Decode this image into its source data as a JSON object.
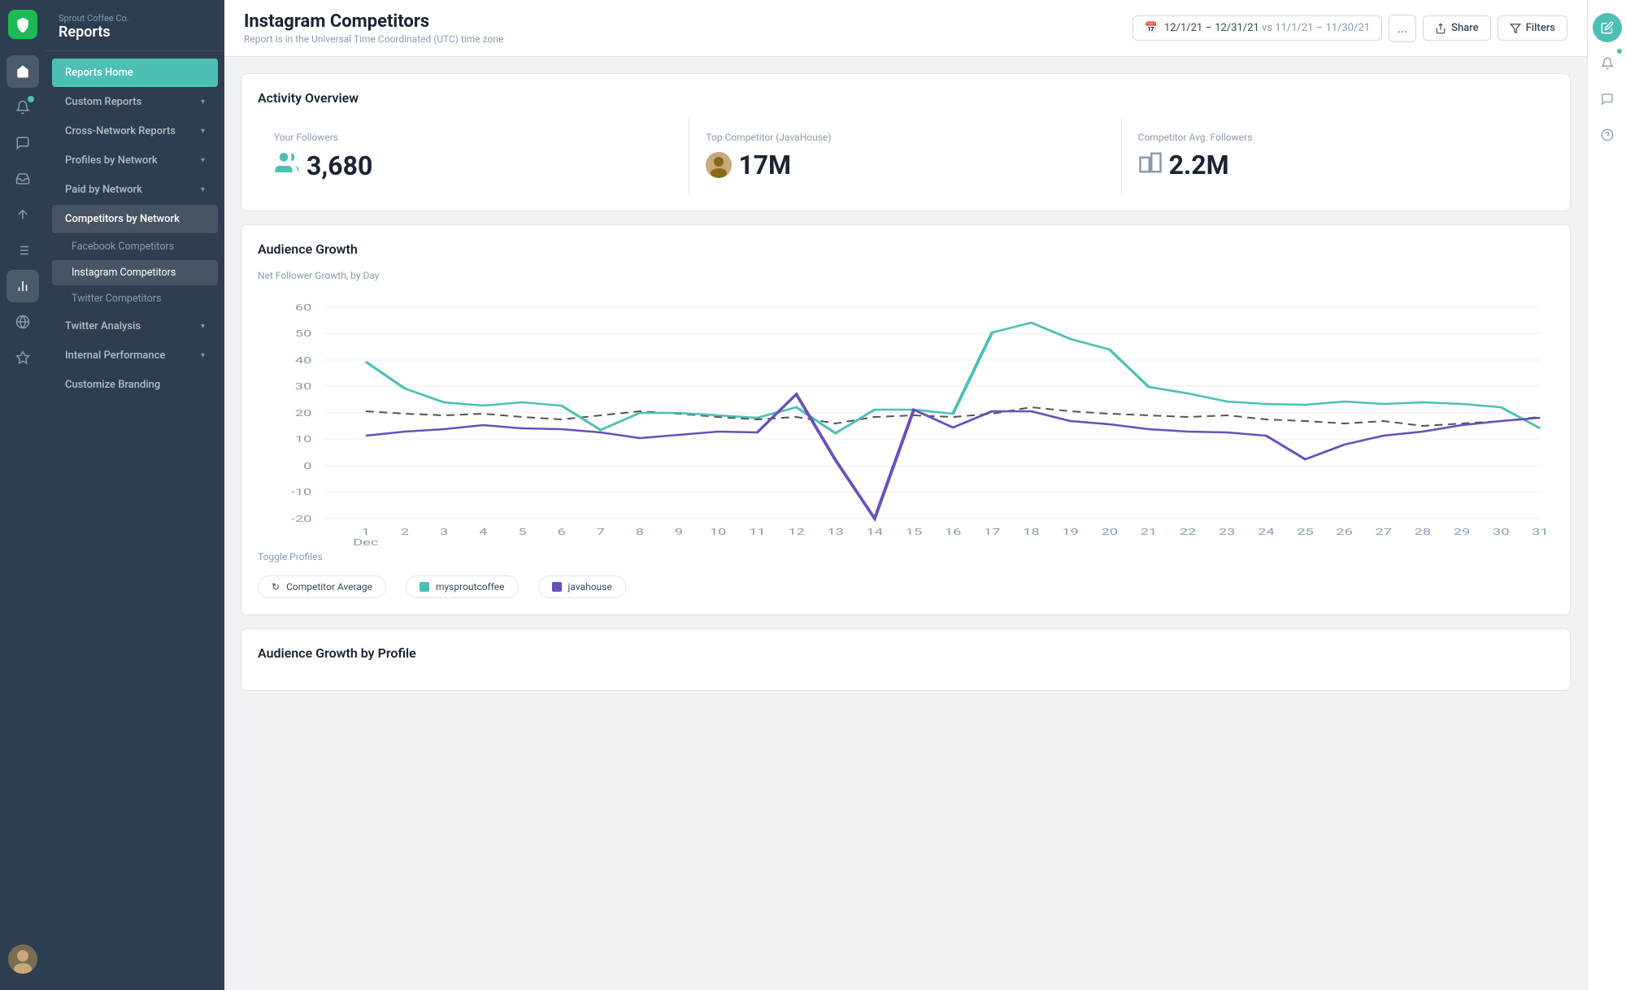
{
  "company": "Sprout Coffee Co.",
  "app_title": "Reports",
  "page_title": "Instagram Competitors",
  "page_subtitle": "Report is in the Universal Time Coordinated (UTC) time zone",
  "date_range": "12/1/21 – 12/31/21",
  "date_compare": "vs 11/1/21 – 11/30/21",
  "header_buttons": {
    "share": "Share",
    "filters": "Filters",
    "more": "..."
  },
  "sidebar": {
    "reports_home": "Reports Home",
    "custom_reports": "Custom Reports",
    "cross_network": "Cross-Network Reports",
    "profiles_by_network": "Profiles by Network",
    "paid_by_network": "Paid by Network",
    "competitors_by_network": "Competitors by Network",
    "facebook_competitors": "Facebook Competitors",
    "instagram_competitors": "Instagram Competitors",
    "twitter_competitors": "Twitter Competitors",
    "twitter_analysis": "Twitter Analysis",
    "internal_performance": "Internal Performance",
    "customize_branding": "Customize Branding"
  },
  "activity_overview": {
    "title": "Activity Overview",
    "your_followers_label": "Your Followers",
    "your_followers_value": "3,680",
    "top_competitor_label": "Top Competitor (JavaHouse)",
    "top_competitor_value": "17M",
    "avg_followers_label": "Competitor Avg. Followers",
    "avg_followers_value": "2.2M"
  },
  "audience_growth": {
    "title": "Audience Growth",
    "chart_label": "Net Follower Growth, by Day",
    "toggle_label": "Toggle Profiles",
    "legend": [
      {
        "id": "competitor_avg",
        "label": "Competitor Average",
        "color": "#555",
        "type": "dashed"
      },
      {
        "id": "mysprout",
        "label": "mysproutcoffee",
        "color": "#4dc0b5",
        "type": "solid"
      },
      {
        "id": "javahouse",
        "label": "javahouse",
        "color": "#6b4fbb",
        "type": "solid"
      }
    ],
    "y_axis": [
      60,
      50,
      40,
      30,
      20,
      10,
      0,
      -10,
      -20
    ],
    "x_axis": [
      "1",
      "2",
      "3",
      "4",
      "5",
      "6",
      "7",
      "8",
      "9",
      "10",
      "11",
      "12",
      "13",
      "14",
      "15",
      "16",
      "17",
      "18",
      "19",
      "20",
      "21",
      "22",
      "23",
      "24",
      "25",
      "26",
      "27",
      "28",
      "29",
      "30",
      "31"
    ],
    "x_label": "Dec"
  },
  "audience_growth_profile": {
    "title": "Audience Growth by Profile"
  },
  "colors": {
    "teal": "#4dc0b5",
    "purple": "#6b4fbb",
    "sidebar_bg": "#2e3d4f",
    "active_item": "#3d8b7a"
  }
}
